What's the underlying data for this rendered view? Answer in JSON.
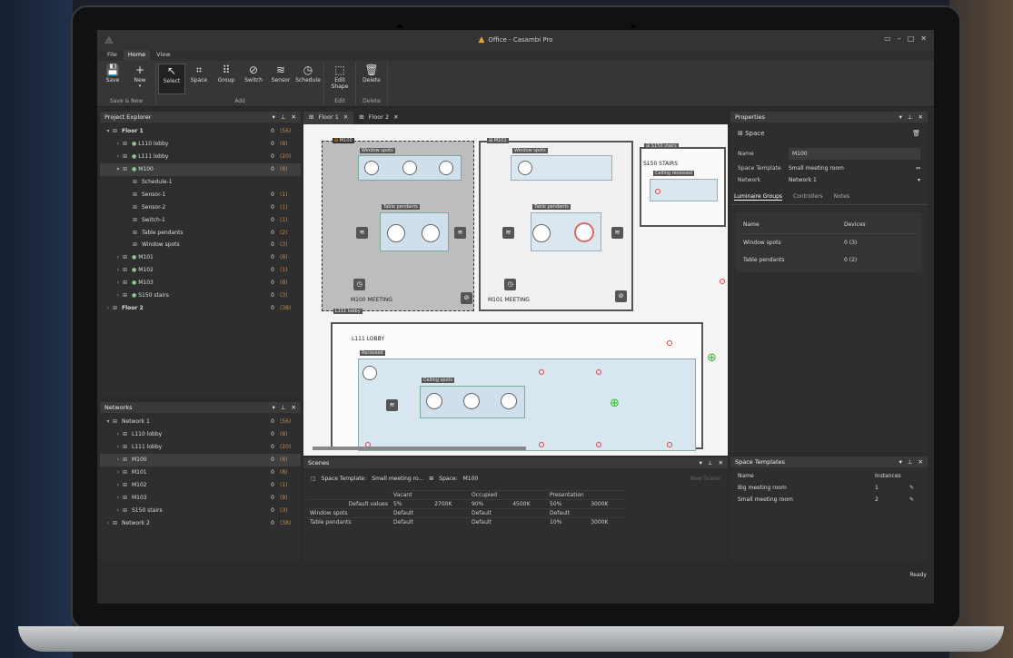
{
  "window": {
    "title": "Office - Casambi Pro",
    "logo": "casambi-logo-icon",
    "controls": [
      "chat-icon",
      "minimize-icon",
      "maximize-icon",
      "close-icon"
    ]
  },
  "menu": [
    "File",
    "Home",
    "View"
  ],
  "ribbon": {
    "groups": [
      {
        "label": "Save & New",
        "buttons": [
          {
            "label": "Save",
            "icon": "save-icon"
          },
          {
            "label": "New",
            "icon": "plus-icon"
          }
        ]
      },
      {
        "label": "Add",
        "buttons": [
          {
            "label": "Select",
            "icon": "cursor-icon"
          },
          {
            "label": "Space",
            "icon": "space-icon"
          },
          {
            "label": "Group",
            "icon": "group-icon"
          },
          {
            "label": "Switch",
            "icon": "switch-icon"
          },
          {
            "label": "Sensor",
            "icon": "sensor-icon"
          },
          {
            "label": "Schedule",
            "icon": "schedule-icon"
          }
        ]
      },
      {
        "label": "Edit",
        "buttons": [
          {
            "label": "Edit Shape",
            "icon": "edit-shape-icon"
          }
        ]
      },
      {
        "label": "Delete",
        "buttons": [
          {
            "label": "Delete",
            "icon": "trash-icon"
          }
        ]
      }
    ]
  },
  "project_explorer": {
    "title": "Project Explorer",
    "rows": [
      {
        "label": "Floor 1",
        "c0": "0",
        "c1": "(56)",
        "indent": 0,
        "arrow": "▾",
        "bold": true
      },
      {
        "label": "L110 lobby",
        "c0": "0",
        "c1": "(8)",
        "indent": 1,
        "arrow": "›",
        "dot": true
      },
      {
        "label": "L111 lobby",
        "c0": "0",
        "c1": "(20)",
        "indent": 1,
        "arrow": "›",
        "dot": true
      },
      {
        "label": "M100",
        "c0": "0",
        "c1": "(8)",
        "indent": 1,
        "arrow": "▾",
        "dot": true,
        "sel": true
      },
      {
        "label": "Schedule-1",
        "c0": "",
        "c1": "",
        "indent": 2
      },
      {
        "label": "Sensor-1",
        "c0": "0",
        "c1": "(1)",
        "indent": 2
      },
      {
        "label": "Sensor-2",
        "c0": "0",
        "c1": "(1)",
        "indent": 2
      },
      {
        "label": "Switch-1",
        "c0": "0",
        "c1": "(1)",
        "indent": 2
      },
      {
        "label": "Table pendants",
        "c0": "0",
        "c1": "(2)",
        "indent": 2
      },
      {
        "label": "Window spots",
        "c0": "0",
        "c1": "(3)",
        "indent": 2
      },
      {
        "label": "M101",
        "c0": "0",
        "c1": "(8)",
        "indent": 1,
        "arrow": "›",
        "dot": true
      },
      {
        "label": "M102",
        "c0": "0",
        "c1": "(1)",
        "indent": 1,
        "arrow": "›",
        "dot": true
      },
      {
        "label": "M103",
        "c0": "0",
        "c1": "(8)",
        "indent": 1,
        "arrow": "›",
        "dot": true
      },
      {
        "label": "S150 stairs",
        "c0": "0",
        "c1": "(3)",
        "indent": 1,
        "arrow": "›",
        "dot": true
      },
      {
        "label": "Floor 2",
        "c0": "0",
        "c1": "(38)",
        "indent": 0,
        "arrow": "›",
        "bold": true
      }
    ]
  },
  "networks": {
    "title": "Networks",
    "rows": [
      {
        "label": "Network 1",
        "c0": "0",
        "c1": "(56)",
        "indent": 0,
        "arrow": "▾"
      },
      {
        "label": "L110 lobby",
        "c0": "0",
        "c1": "(8)",
        "indent": 1,
        "arrow": "›"
      },
      {
        "label": "L111 lobby",
        "c0": "0",
        "c1": "(20)",
        "indent": 1,
        "arrow": "›"
      },
      {
        "label": "M100",
        "c0": "0",
        "c1": "(8)",
        "indent": 1,
        "arrow": "›",
        "sel": true
      },
      {
        "label": "M101",
        "c0": "0",
        "c1": "(8)",
        "indent": 1,
        "arrow": "›"
      },
      {
        "label": "M102",
        "c0": "0",
        "c1": "(1)",
        "indent": 1,
        "arrow": "›"
      },
      {
        "label": "M103",
        "c0": "0",
        "c1": "(8)",
        "indent": 1,
        "arrow": "›"
      },
      {
        "label": "S150 stairs",
        "c0": "0",
        "c1": "(3)",
        "indent": 1,
        "arrow": "›"
      },
      {
        "label": "Network 2",
        "c0": "0",
        "c1": "(38)",
        "indent": 0,
        "arrow": "›"
      }
    ]
  },
  "doc_tabs": [
    {
      "label": "Floor 1",
      "active": true
    },
    {
      "label": "Floor 2",
      "active": false
    }
  ],
  "canvas": {
    "m100_tag": "M100",
    "m101_tag": "M101",
    "s150_tag": "S150 stairs",
    "window_spots": "Window spots",
    "table_pendants": "Table pendants",
    "m100_label": "M100 MEETING",
    "m101_label": "M101 MEETING",
    "s150_label": "S150 STAIRS",
    "ceiling_recessed": "Ceiling recessed",
    "lobby_tag": "L111 lobby",
    "lobby_label": "L111 LOBBY",
    "recessed": "Recessed",
    "ceiling_spots": "Ceiling spots"
  },
  "scenes": {
    "title": "Scenes",
    "space_template_label": "Space Template:",
    "space_template_value": "Small meeting ro...",
    "space_label": "Space:",
    "space_value": "M100",
    "new_scene": "New Scene",
    "columns": [
      "Vacant",
      "Occupied",
      "Presentation"
    ],
    "rows": [
      {
        "name": "Default values",
        "cells": [
          "5%",
          "2700K",
          "90%",
          "4500K",
          "50%",
          "3000K"
        ]
      },
      {
        "name": "Window spots",
        "cells": [
          "Default",
          "",
          "Default",
          "",
          "Default",
          ""
        ]
      },
      {
        "name": "Table pendants",
        "cells": [
          "Default",
          "",
          "Default",
          "",
          "10%",
          "3000K"
        ]
      }
    ]
  },
  "properties": {
    "title": "Properties",
    "header": "Space",
    "fields": [
      {
        "label": "Name",
        "value": "M100"
      },
      {
        "label": "Space Template",
        "value": "Small meeting room"
      },
      {
        "label": "Network",
        "value": "Network 1"
      }
    ],
    "tabs": [
      "Luminaire Groups",
      "Controllers",
      "Notes"
    ],
    "groups_header": [
      "Name",
      "Devices"
    ],
    "groups": [
      {
        "name": "Window spots",
        "devices": "0  (3)"
      },
      {
        "name": "Table pendants",
        "devices": "0  (2)"
      }
    ]
  },
  "space_templates": {
    "title": "Space Templates",
    "header": [
      "Name",
      "Instances"
    ],
    "rows": [
      {
        "name": "Big meeting room",
        "instances": "1"
      },
      {
        "name": "Small meeting room",
        "instances": "2"
      }
    ]
  },
  "status": "Ready"
}
